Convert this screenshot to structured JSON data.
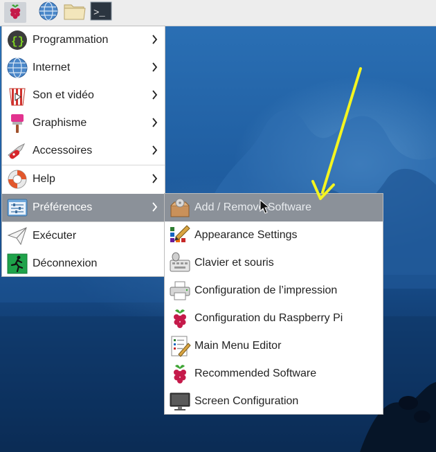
{
  "panel": {
    "buttons": [
      {
        "icon": "raspberry-icon"
      },
      {
        "icon": "globe-icon"
      },
      {
        "icon": "folder-icon"
      },
      {
        "icon": "terminal-icon",
        "text": ">_"
      }
    ]
  },
  "menu": {
    "items": [
      {
        "label": "Programmation",
        "icon": "braces-icon"
      },
      {
        "label": "Internet",
        "icon": "globe-icon"
      },
      {
        "label": "Son et vidéo",
        "icon": "video-icon"
      },
      {
        "label": "Graphisme",
        "icon": "brush-icon"
      },
      {
        "label": "Accessoires",
        "icon": "knife-icon"
      },
      {
        "label": "Help",
        "icon": "lifebuoy-icon"
      },
      {
        "label": "Préférences",
        "icon": "preferences-icon"
      },
      {
        "label": "Exécuter",
        "icon": "paper-plane-icon"
      },
      {
        "label": "Déconnexion",
        "icon": "exit-icon"
      }
    ]
  },
  "submenu": {
    "items": [
      {
        "label": "Add / Remove Software",
        "icon": "package-icon"
      },
      {
        "label": "Appearance Settings",
        "icon": "palette-icon"
      },
      {
        "label": "Clavier et souris",
        "icon": "keyboard-mouse-icon"
      },
      {
        "label": "Configuration de l’impression",
        "icon": "printer-icon"
      },
      {
        "label": "Configuration du Raspberry Pi",
        "icon": "raspberry-icon"
      },
      {
        "label": "Main Menu Editor",
        "icon": "menu-editor-icon"
      },
      {
        "label": "Recommended Software",
        "icon": "raspberry-icon"
      },
      {
        "label": "Screen Configuration",
        "icon": "monitor-icon"
      }
    ]
  },
  "colors": {
    "highlight": "#8b9199",
    "annotation_arrow": "#f4f520"
  }
}
